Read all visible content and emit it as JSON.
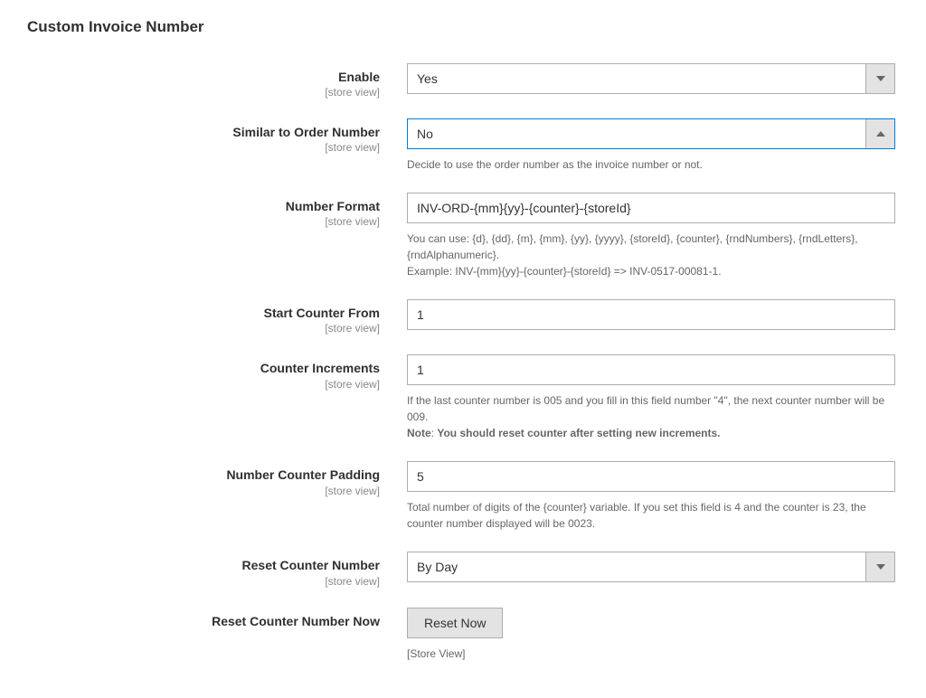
{
  "sectionTitle": "Custom Invoice Number",
  "scopeLabel": "[store view]",
  "fields": {
    "enable": {
      "label": "Enable",
      "value": "Yes"
    },
    "similarToOrder": {
      "label": "Similar to Order Number",
      "value": "No",
      "help": "Decide to use the order number as the invoice number or not."
    },
    "numberFormat": {
      "label": "Number Format",
      "value": "INV-ORD-{mm}{yy}-{counter}-{storeId}",
      "help1": "You can use: {d}, {dd}, {m}, {mm}, {yy}, {yyyy}, {storeId}, {counter}, {rndNumbers}, {rndLetters}, {rndAlphanumeric}.",
      "help2": "Example: INV-{mm}{yy}-{counter}-{storeId} => INV-0517-00081-1."
    },
    "startCounter": {
      "label": "Start Counter From",
      "value": "1"
    },
    "counterIncrements": {
      "label": "Counter Increments",
      "value": "1",
      "help1": "If the last counter number is 005 and you fill in this field number \"4\", the next counter number will be 009.",
      "noteBold": "Note",
      "noteText": ": ",
      "noteBoldText": "You should reset counter after setting new increments."
    },
    "padding": {
      "label": "Number Counter Padding",
      "value": "5",
      "help": "Total number of digits of the {counter} variable. If you set this field is 4 and the counter is 23, the counter number displayed will be 0023."
    },
    "resetCounter": {
      "label": "Reset Counter Number",
      "value": "By Day"
    },
    "resetNow": {
      "label": "Reset Counter Number Now",
      "buttonLabel": "Reset Now",
      "below": "[Store View]"
    }
  }
}
